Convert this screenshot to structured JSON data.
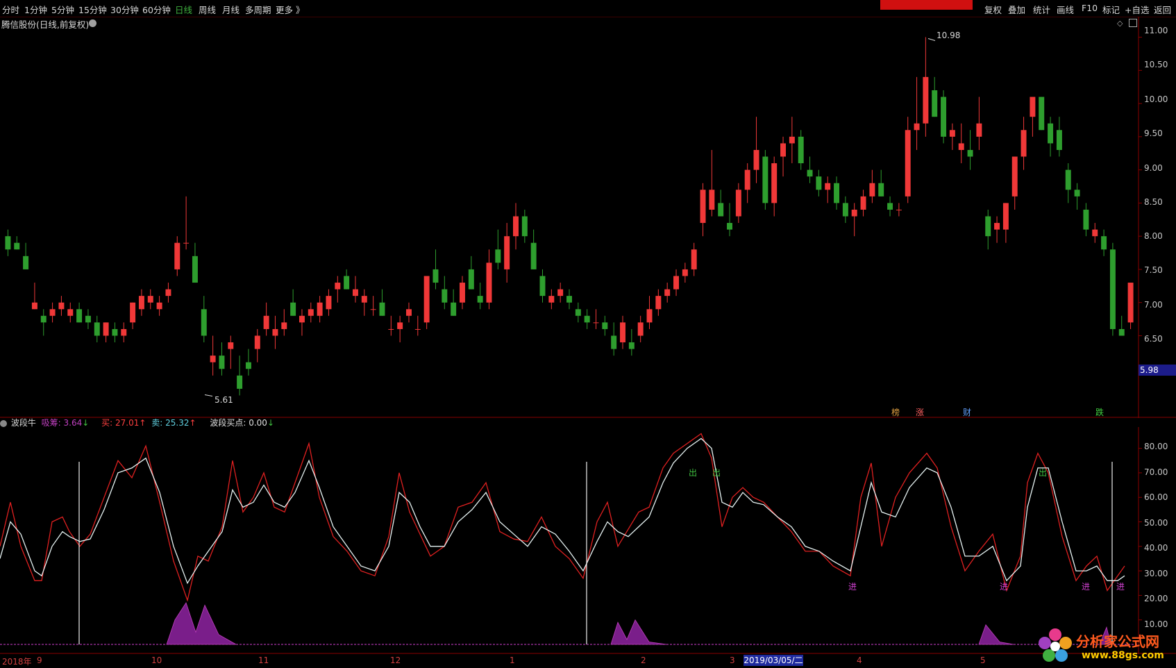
{
  "toolbar": {
    "periods": [
      "分时",
      "1分钟",
      "5分钟",
      "15分钟",
      "30分钟",
      "60分钟",
      "日线",
      "周线",
      "月线",
      "多周期",
      "更多 》"
    ],
    "active_period": "日线",
    "right_items": [
      "复权",
      "叠加",
      "统计",
      "画线",
      "F10",
      "标记",
      "+自选",
      "返回"
    ]
  },
  "main": {
    "title": "腾信股份(日线,前复权)",
    "high_label": "10.98",
    "low_label": "5.61",
    "price_axis": [
      "11.00",
      "10.50",
      "10.00",
      "9.50",
      "9.00",
      "8.50",
      "8.00",
      "7.50",
      "7.00",
      "6.50"
    ],
    "current_price": "5.98",
    "event_tags": [
      {
        "text": "榜",
        "color": "#e0a040"
      },
      {
        "text": "涨",
        "color": "#ff6060"
      },
      {
        "text": "财",
        "color": "#60a0ff"
      },
      {
        "text": "跌",
        "color": "#40d040"
      }
    ]
  },
  "indicator": {
    "name": "波段牛",
    "chip_label": "吸筹: 3.64",
    "chip_arrow": "↓",
    "buy_label": "买: 27.01",
    "buy_arrow": "↑",
    "sell_label": "卖: 25.32",
    "sell_arrow": "↑",
    "point_label": "波段买点: 0.00",
    "point_arrow": "↓",
    "axis": [
      "80.00",
      "70.00",
      "60.00",
      "50.00",
      "40.00",
      "30.00",
      "20.00",
      "10.00"
    ],
    "signals_out": "出",
    "signals_in": "进"
  },
  "date_axis": {
    "labels": [
      "2018年",
      "9",
      "10",
      "11",
      "12",
      "1",
      "2",
      "3",
      "4",
      "5"
    ],
    "cursor": "2019/03/05/二"
  },
  "logo": {
    "text": "分析家公式网",
    "url_text": "www.88gs.com"
  },
  "chart_data": {
    "type": "candlestick",
    "title": "腾信股份(日线,前复权)",
    "ylim": [
      5.5,
      11.1
    ],
    "high": 10.98,
    "low": 5.61,
    "current": 5.98,
    "ohlc": [
      [
        8.0,
        8.1,
        7.7,
        7.8
      ],
      [
        7.9,
        8.0,
        7.8,
        7.8
      ],
      [
        7.7,
        7.9,
        7.5,
        7.5
      ],
      [
        6.9,
        7.3,
        6.9,
        7.0
      ],
      [
        6.8,
        6.9,
        6.5,
        6.7
      ],
      [
        6.8,
        7.0,
        6.7,
        6.9
      ],
      [
        6.9,
        7.1,
        6.8,
        7.0
      ],
      [
        6.8,
        7.0,
        6.7,
        6.9
      ],
      [
        6.9,
        7.0,
        6.7,
        6.7
      ],
      [
        6.8,
        6.9,
        6.6,
        6.7
      ],
      [
        6.7,
        6.8,
        6.4,
        6.5
      ],
      [
        6.5,
        6.7,
        6.4,
        6.7
      ],
      [
        6.6,
        6.7,
        6.4,
        6.5
      ],
      [
        6.5,
        6.7,
        6.4,
        6.6
      ],
      [
        6.7,
        7.0,
        6.6,
        7.0
      ],
      [
        6.9,
        7.2,
        6.8,
        7.1
      ],
      [
        7.0,
        7.2,
        6.9,
        7.1
      ],
      [
        6.9,
        7.1,
        6.8,
        7.0
      ],
      [
        7.1,
        7.3,
        7.0,
        7.2
      ],
      [
        7.5,
        8.0,
        7.4,
        7.9
      ],
      [
        7.9,
        8.6,
        7.8,
        7.9
      ],
      [
        7.7,
        7.9,
        7.3,
        7.3
      ],
      [
        6.9,
        7.1,
        6.4,
        6.5
      ],
      [
        6.1,
        6.5,
        5.9,
        6.2
      ],
      [
        6.2,
        6.4,
        5.9,
        6.0
      ],
      [
        6.3,
        6.5,
        6.0,
        6.4
      ],
      [
        5.9,
        6.2,
        5.6,
        5.7
      ],
      [
        6.1,
        6.3,
        5.9,
        6.0
      ],
      [
        6.3,
        6.6,
        6.1,
        6.5
      ],
      [
        6.6,
        7.0,
        6.5,
        6.8
      ],
      [
        6.5,
        6.8,
        6.3,
        6.6
      ],
      [
        6.6,
        6.9,
        6.5,
        6.7
      ],
      [
        7.0,
        7.2,
        6.8,
        6.8
      ],
      [
        6.7,
        6.9,
        6.5,
        6.8
      ],
      [
        6.8,
        7.0,
        6.7,
        6.9
      ],
      [
        6.8,
        7.1,
        6.7,
        7.0
      ],
      [
        6.9,
        7.2,
        6.8,
        7.1
      ],
      [
        7.2,
        7.4,
        7.0,
        7.3
      ],
      [
        7.4,
        7.5,
        7.2,
        7.2
      ],
      [
        7.1,
        7.4,
        7.0,
        7.2
      ],
      [
        7.0,
        7.2,
        6.8,
        7.1
      ],
      [
        6.9,
        7.1,
        6.8,
        6.9
      ],
      [
        7.0,
        7.2,
        6.8,
        6.8
      ],
      [
        6.6,
        6.8,
        6.5,
        6.6
      ],
      [
        6.6,
        6.8,
        6.4,
        6.7
      ],
      [
        6.8,
        7.0,
        6.7,
        6.9
      ],
      [
        6.6,
        6.8,
        6.5,
        6.6
      ],
      [
        6.7,
        7.4,
        6.6,
        7.4
      ],
      [
        7.5,
        7.8,
        7.2,
        7.3
      ],
      [
        7.2,
        7.4,
        6.9,
        7.0
      ],
      [
        7.0,
        7.2,
        6.8,
        6.8
      ],
      [
        7.0,
        7.4,
        6.9,
        7.3
      ],
      [
        7.5,
        7.7,
        7.2,
        7.2
      ],
      [
        7.1,
        7.3,
        6.9,
        7.0
      ],
      [
        7.0,
        7.8,
        6.9,
        7.6
      ],
      [
        7.8,
        8.1,
        7.5,
        7.6
      ],
      [
        7.5,
        8.2,
        7.3,
        8.0
      ],
      [
        8.0,
        8.5,
        7.8,
        8.3
      ],
      [
        8.3,
        8.4,
        7.9,
        8.0
      ],
      [
        7.9,
        8.1,
        7.5,
        7.5
      ],
      [
        7.4,
        7.5,
        7.0,
        7.1
      ],
      [
        7.0,
        7.2,
        6.9,
        7.1
      ],
      [
        7.1,
        7.3,
        7.0,
        7.2
      ],
      [
        7.1,
        7.2,
        6.9,
        7.0
      ],
      [
        6.9,
        7.0,
        6.7,
        6.8
      ],
      [
        6.8,
        6.9,
        6.6,
        6.7
      ],
      [
        6.7,
        6.9,
        6.6,
        6.7
      ],
      [
        6.7,
        6.8,
        6.5,
        6.6
      ],
      [
        6.5,
        6.7,
        6.2,
        6.3
      ],
      [
        6.4,
        6.8,
        6.3,
        6.7
      ],
      [
        6.4,
        6.6,
        6.2,
        6.3
      ],
      [
        6.5,
        6.8,
        6.4,
        6.7
      ],
      [
        6.7,
        7.1,
        6.6,
        6.9
      ],
      [
        6.9,
        7.2,
        6.8,
        7.1
      ],
      [
        7.1,
        7.3,
        7.0,
        7.2
      ],
      [
        7.2,
        7.5,
        7.1,
        7.4
      ],
      [
        7.4,
        7.6,
        7.3,
        7.5
      ],
      [
        7.5,
        7.9,
        7.4,
        7.8
      ],
      [
        8.2,
        8.8,
        8.0,
        8.7
      ],
      [
        8.4,
        9.3,
        8.3,
        8.7
      ],
      [
        8.5,
        8.7,
        8.3,
        8.3
      ],
      [
        8.2,
        8.5,
        8.0,
        8.1
      ],
      [
        8.3,
        8.8,
        8.2,
        8.7
      ],
      [
        8.7,
        9.1,
        8.5,
        9.0
      ],
      [
        9.0,
        9.8,
        8.8,
        9.3
      ],
      [
        9.2,
        9.3,
        8.4,
        8.5
      ],
      [
        8.5,
        9.2,
        8.3,
        9.1
      ],
      [
        9.2,
        9.5,
        8.9,
        9.4
      ],
      [
        9.4,
        9.8,
        9.1,
        9.5
      ],
      [
        9.5,
        9.6,
        9.0,
        9.1
      ],
      [
        9.0,
        9.2,
        8.8,
        8.9
      ],
      [
        8.9,
        9.0,
        8.6,
        8.7
      ],
      [
        8.7,
        8.9,
        8.5,
        8.8
      ],
      [
        8.8,
        8.9,
        8.4,
        8.5
      ],
      [
        8.5,
        8.6,
        8.2,
        8.3
      ],
      [
        8.3,
        8.5,
        8.0,
        8.4
      ],
      [
        8.4,
        8.7,
        8.3,
        8.6
      ],
      [
        8.6,
        9.0,
        8.5,
        8.8
      ],
      [
        8.8,
        9.0,
        8.6,
        8.6
      ],
      [
        8.5,
        8.6,
        8.3,
        8.4
      ],
      [
        8.4,
        8.5,
        8.3,
        8.4
      ],
      [
        8.6,
        9.8,
        8.5,
        9.6
      ],
      [
        9.6,
        10.4,
        9.3,
        9.7
      ],
      [
        9.7,
        11.0,
        9.5,
        10.4
      ],
      [
        10.2,
        10.4,
        9.8,
        9.8
      ],
      [
        10.1,
        10.2,
        9.4,
        9.5
      ],
      [
        9.5,
        9.7,
        9.3,
        9.6
      ],
      [
        9.3,
        9.7,
        9.1,
        9.4
      ],
      [
        9.3,
        9.6,
        9.0,
        9.2
      ],
      [
        9.5,
        10.1,
        9.3,
        9.7
      ],
      [
        8.3,
        8.4,
        7.8,
        8.0
      ],
      [
        8.1,
        8.3,
        7.9,
        8.2
      ],
      [
        8.1,
        8.5,
        7.9,
        8.5
      ],
      [
        8.6,
        9.0,
        8.4,
        9.2
      ],
      [
        9.2,
        9.8,
        9.0,
        9.6
      ],
      [
        9.8,
        10.1,
        9.5,
        10.1
      ],
      [
        10.1,
        10.1,
        9.6,
        9.6
      ],
      [
        9.7,
        9.8,
        9.2,
        9.4
      ],
      [
        9.6,
        9.8,
        9.2,
        9.3
      ],
      [
        9.0,
        9.1,
        8.5,
        8.7
      ],
      [
        8.7,
        8.8,
        8.4,
        8.6
      ],
      [
        8.4,
        8.5,
        8.0,
        8.1
      ],
      [
        8.0,
        8.2,
        7.9,
        8.1
      ],
      [
        8.0,
        8.1,
        7.7,
        7.8
      ],
      [
        7.8,
        7.9,
        6.5,
        6.6
      ],
      [
        6.6,
        6.8,
        6.5,
        6.5
      ],
      [
        6.7,
        7.3,
        6.6,
        7.3
      ]
    ]
  }
}
